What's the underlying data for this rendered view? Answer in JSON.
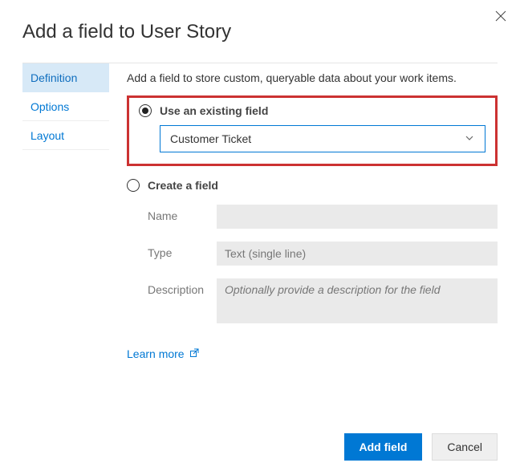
{
  "dialog": {
    "title": "Add a field to User Story",
    "close_aria": "Close"
  },
  "tabs": {
    "definition": "Definition",
    "options": "Options",
    "layout": "Layout"
  },
  "panel": {
    "intro": "Add a field to store custom, queryable data about your work items.",
    "use_existing_label": "Use an existing field",
    "field_select_value": "Customer Ticket",
    "create_label": "Create a field",
    "name_label": "Name",
    "name_value": "",
    "type_label": "Type",
    "type_value": "Text (single line)",
    "description_label": "Description",
    "description_placeholder": "Optionally provide a description for the field",
    "learn_more": "Learn more"
  },
  "footer": {
    "primary": "Add field",
    "secondary": "Cancel"
  }
}
